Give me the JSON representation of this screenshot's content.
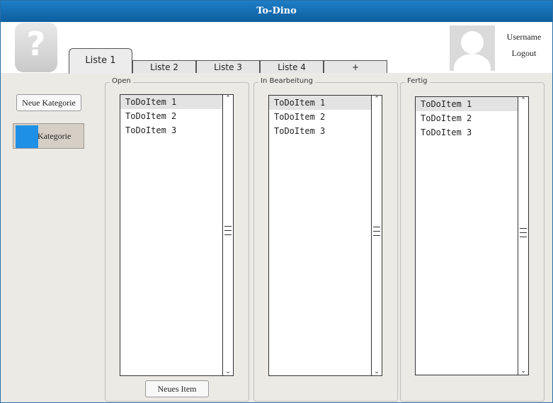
{
  "window": {
    "title": "To-Dino"
  },
  "header": {
    "user_label": "Username",
    "logout_label": "Logout",
    "logo_glyph": "?"
  },
  "tabs": [
    "Liste 1",
    "Liste 2",
    "Liste 3",
    "Liste 4",
    "+"
  ],
  "sidebar": {
    "new_category_label": "Neue Kategorie",
    "category_label": "Kategorie",
    "category_color": "#1e90e6"
  },
  "columns": [
    {
      "title": "Open",
      "items": [
        "ToDoItem 1",
        "ToDoItem 2",
        "ToDoItem 3"
      ]
    },
    {
      "title": "In Bearbeitung",
      "items": [
        "ToDoItem 1",
        "ToDoItem 2",
        "ToDoItem 3"
      ]
    },
    {
      "title": "Fertig",
      "items": [
        "ToDoItem 1",
        "ToDoItem 2",
        "ToDoItem 3"
      ]
    }
  ],
  "new_item_label": "Neues Item",
  "scroll_icons": {
    "up": "chevron-up-icon",
    "down": "chevron-down-icon"
  }
}
